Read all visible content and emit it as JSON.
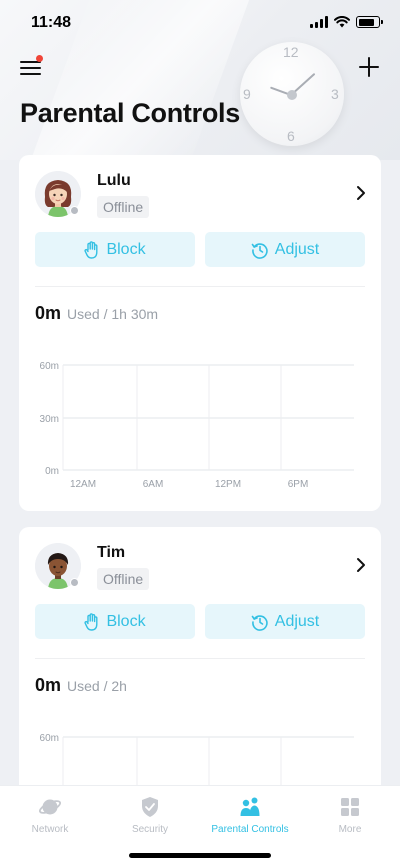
{
  "status_bar": {
    "time": "11:48",
    "battery_level": 0.8
  },
  "header": {
    "title": "Parental Controls",
    "menu_has_notification": true
  },
  "clock_numbers": {
    "twelve": "12",
    "three": "3",
    "six": "6",
    "nine": "9"
  },
  "profiles": [
    {
      "name": "Lulu",
      "status": "Offline",
      "block_label": "Block",
      "adjust_label": "Adjust",
      "usage_value": "0m",
      "usage_limit": "Used / 1h 30m",
      "avatar_icon": "girl-avatar-icon",
      "chart": {
        "y_ticks": [
          "60m",
          "30m",
          "0m"
        ],
        "x_ticks": [
          "12AM",
          "6AM",
          "12PM",
          "6PM"
        ]
      }
    },
    {
      "name": "Tim",
      "status": "Offline",
      "block_label": "Block",
      "adjust_label": "Adjust",
      "usage_value": "0m",
      "usage_limit": "Used / 2h",
      "avatar_icon": "boy-avatar-icon",
      "chart": {
        "y_ticks": [
          "60m"
        ]
      }
    }
  ],
  "tabs": [
    {
      "label": "Network",
      "icon": "planet-icon",
      "active": false
    },
    {
      "label": "Security",
      "icon": "shield-icon",
      "active": false
    },
    {
      "label": "Parental Controls",
      "icon": "family-icon",
      "active": true
    },
    {
      "label": "More",
      "icon": "grid-icon",
      "active": false
    }
  ],
  "colors": {
    "accent": "#33c0e3",
    "button_bg": "#e6f6fb",
    "inactive": "#b8bcc3",
    "notification": "#f04438"
  }
}
